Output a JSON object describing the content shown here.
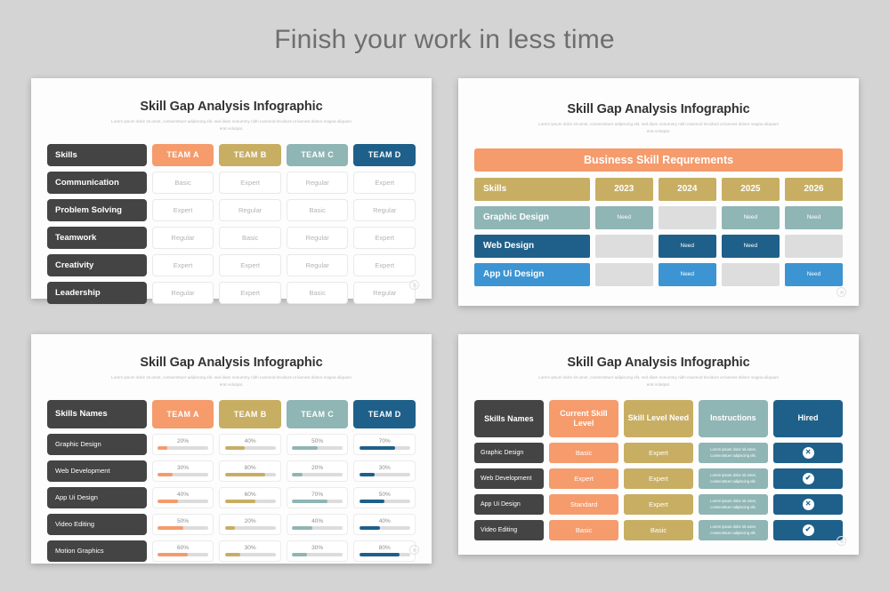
{
  "page": {
    "title": "Finish your work in less time",
    "background": "#d4d4d4"
  },
  "palette": {
    "orange": "#F59B6C",
    "gold": "#C8AE63",
    "teal": "#8FB5B4",
    "darkblue": "#1E6089",
    "brightblue": "#3C94D2",
    "dark": "#444444",
    "empty_gray": "#dddddd"
  },
  "common": {
    "infographic_title": "Skill Gap Analysis Infographic",
    "subtitle": "Lorem ipsum dolor sit amet, consectetuer adipiscing elit, sed diam nonummy nibh euismod tincidunt ut laoreet dolore magna aliquam erat volutpat."
  },
  "card1": {
    "title": "Skill Gap Analysis Infographic",
    "subtitle": "Lorem ipsum dolor sit amet, consectetuer adipiscing elit, sed diam nonummy nibh euismod tincidunt ut laoreet dolore magna aliquam erat volutpat.",
    "header": {
      "skills_label": "Skills",
      "teams": [
        {
          "label": "TEAM A",
          "color": "#F59B6C"
        },
        {
          "label": "TEAM B",
          "color": "#C8AE63"
        },
        {
          "label": "TEAM C",
          "color": "#8FB5B4"
        },
        {
          "label": "TEAM D",
          "color": "#1E6089"
        }
      ]
    },
    "rows": [
      {
        "skill": "Communication",
        "values": [
          "Basic",
          "Expert",
          "Regular",
          "Expert"
        ]
      },
      {
        "skill": "Problem Solving",
        "values": [
          "Expert",
          "Regular",
          "Basic",
          "Regular"
        ]
      },
      {
        "skill": "Teamwork",
        "values": [
          "Regular",
          "Basic",
          "Regular",
          "Expert"
        ]
      },
      {
        "skill": "Creativity",
        "values": [
          "Expert",
          "Expert",
          "Regular",
          "Expert"
        ]
      },
      {
        "skill": "Leadership",
        "values": [
          "Regular",
          "Expert",
          "Basic",
          "Regular"
        ]
      }
    ]
  },
  "card2": {
    "title": "Skill Gap Analysis Infographic",
    "subtitle": "Lorem ipsum dolor sit amet, consectetuer adipiscing elit, sed diam nonummy nibh euismod tincidunt ut laoreet dolore magna aliquam erat volutpat.",
    "banner": "Business Skill Requrements",
    "header": {
      "skills_label": "Skills",
      "years": [
        "2023",
        "2024",
        "2025",
        "2026"
      ]
    },
    "need_label": "Need",
    "rows": [
      {
        "skill": "Graphic Design",
        "color": "#8FB5B4",
        "cells": [
          true,
          false,
          true,
          true
        ]
      },
      {
        "skill": "Web Design",
        "color": "#1E6089",
        "cells": [
          false,
          true,
          true,
          false
        ]
      },
      {
        "skill": "App Ui Design",
        "color": "#3C94D2",
        "cells": [
          false,
          true,
          false,
          true
        ]
      }
    ]
  },
  "card3": {
    "title": "Skill Gap Analysis Infographic",
    "subtitle": "Lorem ipsum dolor sit amet, consectetuer adipiscing elit, sed diam nonummy nibh euismod tincidunt ut laoreet dolore magna aliquam erat volutpat.",
    "header": {
      "skills_label": "Skills Names",
      "teams": [
        {
          "label": "TEAM A",
          "color": "#F59B6C"
        },
        {
          "label": "TEAM B",
          "color": "#C8AE63"
        },
        {
          "label": "TEAM C",
          "color": "#8FB5B4"
        },
        {
          "label": "TEAM D",
          "color": "#1E6089"
        }
      ]
    },
    "rows": [
      {
        "skill": "Graphic Design",
        "percents": [
          "20%",
          "40%",
          "50%",
          "70%"
        ]
      },
      {
        "skill": "Web Development",
        "percents": [
          "30%",
          "80%",
          "20%",
          "30%"
        ]
      },
      {
        "skill": "App Ui Design",
        "percents": [
          "40%",
          "60%",
          "70%",
          "50%"
        ]
      },
      {
        "skill": "Video Editing",
        "percents": [
          "50%",
          "20%",
          "40%",
          "40%"
        ]
      },
      {
        "skill": "Motion Graphics",
        "percents": [
          "60%",
          "30%",
          "30%",
          "80%"
        ]
      }
    ]
  },
  "card4": {
    "title": "Skill Gap Analysis Infographic",
    "subtitle": "Lorem ipsum dolor sit amet, consectetuer adipiscing elit, sed diam nonummy nibh euismod tincidunt ut laoreet dolore magna aliquam erat volutpat.",
    "header": [
      {
        "label": "Skills Names",
        "color": "#444444"
      },
      {
        "label": "Current Skill Level",
        "color": "#F59B6C"
      },
      {
        "label": "Skill Level Need",
        "color": "#C8AE63"
      },
      {
        "label": "Instructions",
        "color": "#8FB5B4"
      },
      {
        "label": "Hired",
        "color": "#1E6089"
      }
    ],
    "instruction_text": "Lorem ipsum dolor sit amet, consectetuer adipiscing elit.",
    "rows": [
      {
        "skill": "Graphic Design",
        "current": "Basic",
        "need": "Expert",
        "instructions": "Lorem ipsum dolor sit amet, consectetuer adipiscing elit.",
        "hired": false
      },
      {
        "skill": "Web Development",
        "current": "Expert",
        "need": "Expert",
        "instructions": "Lorem ipsum dolor sit amet, consectetuer adipiscing elit.",
        "hired": true
      },
      {
        "skill": "App Ui Design",
        "current": "Standard",
        "need": "Expert",
        "instructions": "Lorem ipsum dolor sit amet, consectetuer adipiscing elit.",
        "hired": false
      },
      {
        "skill": "Video Editing",
        "current": "Basic",
        "need": "Basic",
        "instructions": "Lorem ipsum dolor sit amet, consectetuer adipiscing elit.",
        "hired": true
      }
    ],
    "hired_yes_glyph": "✔",
    "hired_no_glyph": "✕"
  }
}
